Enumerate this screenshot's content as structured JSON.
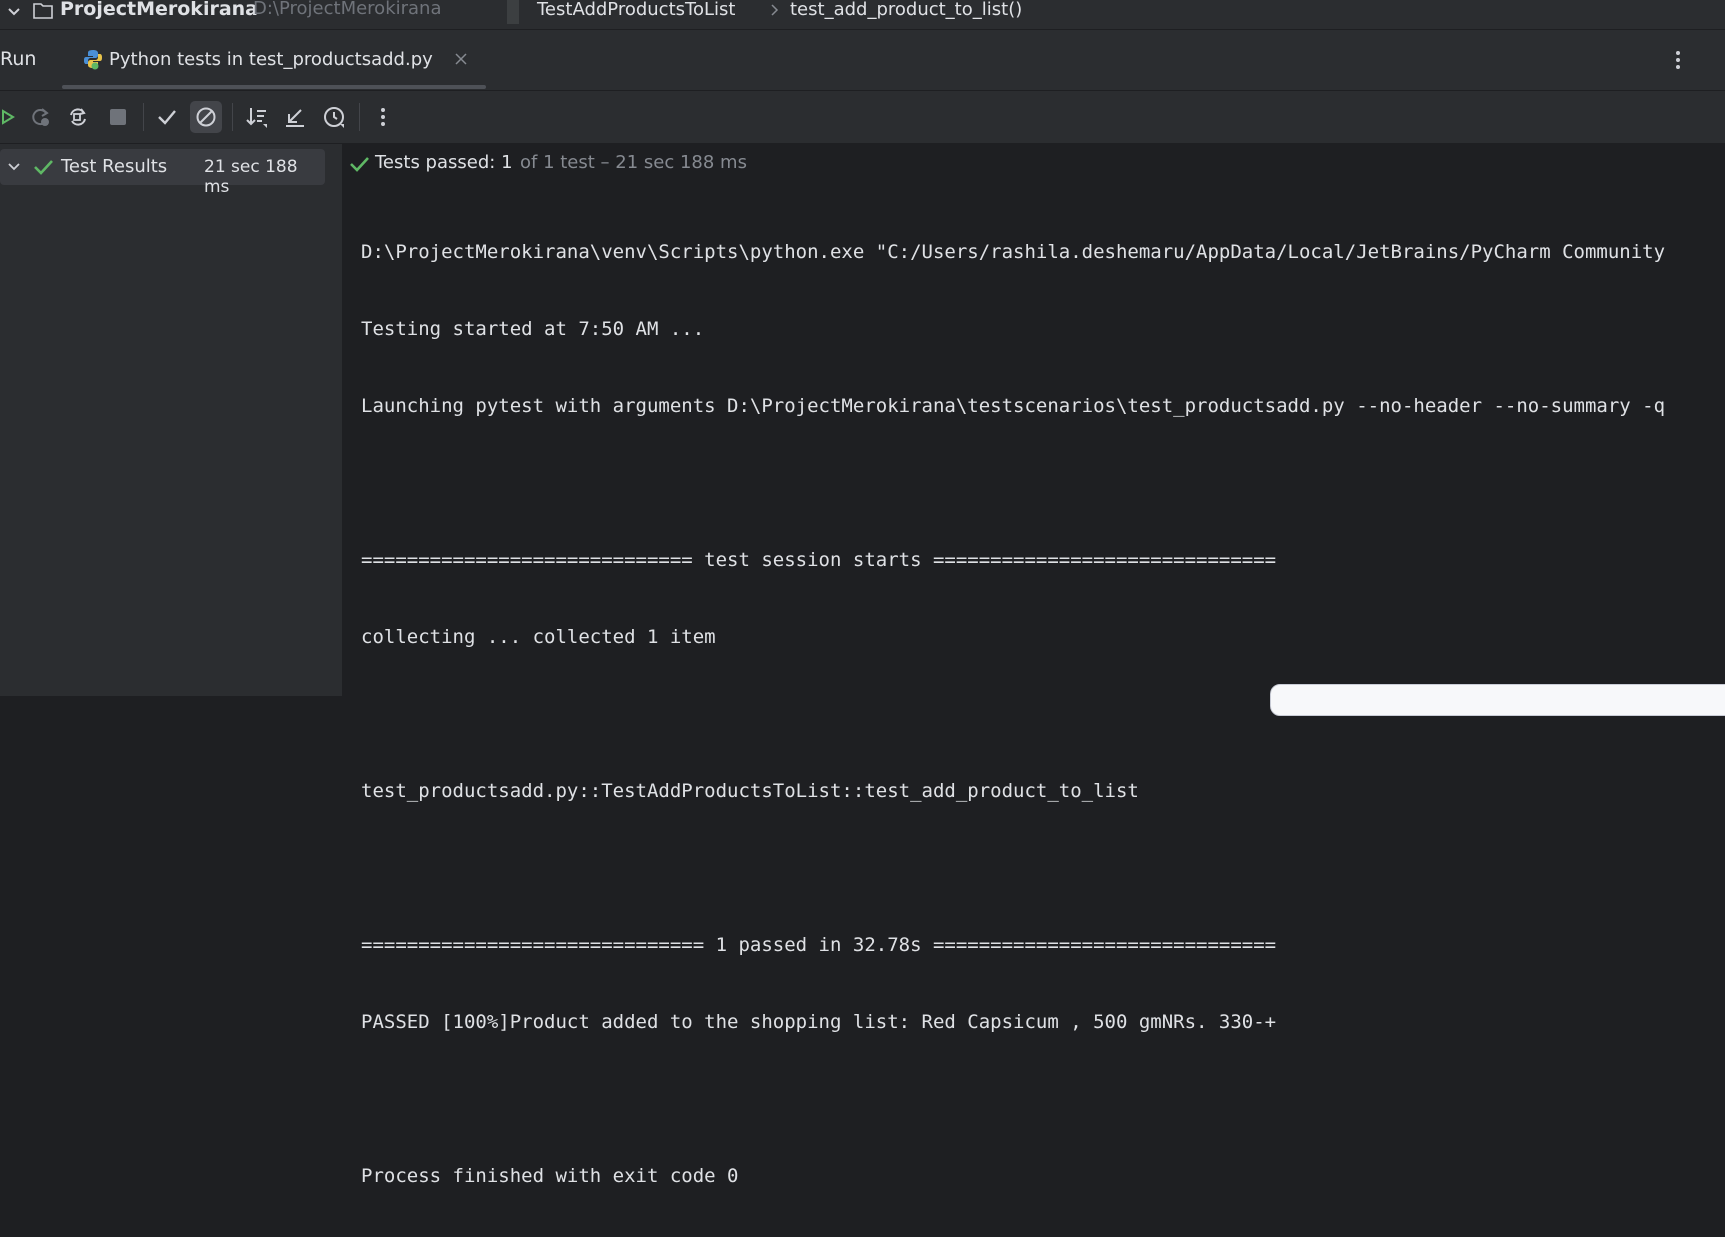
{
  "titlebar": {
    "project_name": "ProjectMerokirana",
    "project_path": "D:\\ProjectMerokirana",
    "breadcrumb": [
      "TestAddProductsToList",
      "test_add_product_to_list()"
    ]
  },
  "run_panel": {
    "title": "Run",
    "tab_label": "Python tests in test_productsadd.py"
  },
  "toolbar": {
    "icons": [
      "rerun-icon",
      "rerun-failed-icon",
      "toggle-auto-test-icon",
      "stop-icon",
      "show-passed-icon",
      "show-ignored-icon",
      "sort-icon",
      "collapse-icon",
      "history-icon",
      "more-icon"
    ]
  },
  "test_tree": {
    "root_label": "Test Results",
    "root_time": "21 sec 188 ms"
  },
  "status": {
    "label": "Tests passed:",
    "count": "1",
    "detail": "of 1 test – 21 sec 188 ms"
  },
  "console": {
    "lines": [
      "D:\\ProjectMerokirana\\venv\\Scripts\\python.exe \"C:/Users/rashila.deshemaru/AppData/Local/JetBrains/PyCharm Community",
      "Testing started at 7:50 AM ...",
      "Launching pytest with arguments D:\\ProjectMerokirana\\testscenarios\\test_productsadd.py --no-header --no-summary -q",
      "",
      "============================= test session starts ==============================",
      "collecting ... collected 1 item",
      "",
      "test_productsadd.py::TestAddProductsToList::test_add_product_to_list",
      "",
      "============================== 1 passed in 32.78s ==============================",
      "PASSED [100%]Product added to the shopping list: Red Capsicum , 500 gmNRs. 330-+",
      "",
      "Process finished with exit code 0"
    ]
  },
  "colors": {
    "success": "#5fb865",
    "panel_bg": "#2b2d30",
    "console_bg": "#1e1f22",
    "text": "#dfe1e5",
    "muted": "#868a91"
  }
}
